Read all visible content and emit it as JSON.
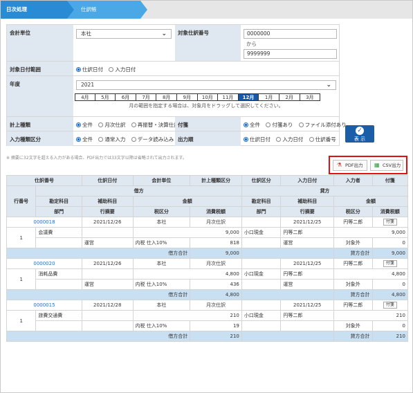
{
  "breadcrumb": {
    "step1": "日次処理",
    "step2": "仕訳帳"
  },
  "filters": {
    "company_label": "会計単位",
    "company_value": "本社",
    "voucher_label": "対象仕訳番号",
    "voucher_from": "0000000",
    "voucher_sep": "から",
    "voucher_to": "9999999",
    "date_target_label": "対象日付範囲",
    "date_target_opt1": "仕訳日付",
    "date_target_opt2": "入力日付",
    "year_label": "年度",
    "year_value": "2021",
    "months": [
      "4月",
      "5月",
      "6月",
      "7月",
      "8月",
      "9月",
      "10月",
      "11月",
      "12月",
      "1月",
      "2月",
      "3月"
    ],
    "selected_month": "12月",
    "month_hint": "月の範囲を指定する場合は、対象月をドラッグして選択してください。",
    "posting_label": "計上種類",
    "posting_opts": [
      "全件",
      "月次仕訳",
      "再振替・決算仕訳"
    ],
    "attach_label": "付箋",
    "attach_opts": [
      "全件",
      "付箋あり",
      "ファイル添付あり"
    ],
    "input_type_label": "入力種類区分",
    "input_type_opts": [
      "全件",
      "通常入力",
      "データ読み込み"
    ],
    "order_label": "出力順",
    "order_opts": [
      "仕訳日付",
      "入力日付",
      "仕訳番号"
    ]
  },
  "show_button": "表 示",
  "note": "※ 摘要に32文字を超える入力がある場合、PDF出力では33文字以降は省略されて出力されます。",
  "pdf_button": "PDF出力",
  "csv_button": "CSV出力",
  "headers": {
    "voucher_no": "仕訳番号",
    "voucher_date": "仕訳日付",
    "unit": "会計単位",
    "posting_type": "計上種類区分",
    "voucher_kind": "仕訳区分",
    "input_date": "入力日付",
    "inputter": "入力者",
    "sticky": "付箋",
    "debit": "借方",
    "credit": "貸方",
    "line_no": "行番号",
    "account": "勘定科目",
    "sub_account": "補助科目",
    "amount": "金額",
    "dept": "部門",
    "summary": "行摘要",
    "tax_class": "税区分",
    "tax_amount": "消費税額"
  },
  "entries": [
    {
      "no": "0000018",
      "date": "2021/12/26",
      "unit": "本社",
      "ptype": "月次仕訳",
      "idate": "2021/12/25",
      "user": "円等二郎",
      "tag": "付箋",
      "line": "1",
      "dacc": "会議費",
      "damt": "9,000",
      "cacc": "小口現金",
      "csub": "円等二郎",
      "camt": "9,000",
      "dsum": "運営",
      "dtax": "内税 仕入10%",
      "dtaxamt": "818",
      "csum": "運営",
      "ctax": "対象外",
      "ctaxamt": "0",
      "dtot_label": "借方合計",
      "dtot": "9,000",
      "ctot_label": "貸方合計",
      "ctot": "9,000"
    },
    {
      "no": "0000020",
      "date": "2021/12/26",
      "unit": "本社",
      "ptype": "月次仕訳",
      "idate": "2021/12/25",
      "user": "円等二郎",
      "tag": "付箋",
      "line": "1",
      "dacc": "消耗品費",
      "damt": "4,800",
      "cacc": "小口現金",
      "csub": "円等二郎",
      "camt": "4,800",
      "dsum": "運営",
      "dtax": "内税 仕入10%",
      "dtaxamt": "436",
      "csum": "運営",
      "ctax": "対象外",
      "ctaxamt": "0",
      "dtot_label": "借方合計",
      "dtot": "4,800",
      "ctot_label": "貸方合計",
      "ctot": "4,800"
    },
    {
      "no": "0000015",
      "date": "2021/12/28",
      "unit": "本社",
      "ptype": "月次仕訳",
      "idate": "2021/12/25",
      "user": "円等二郎",
      "tag": "付箋",
      "line": "1",
      "dacc": "旅費交通費",
      "damt": "210",
      "cacc": "小口現金",
      "csub": "円等二郎",
      "camt": "210",
      "dsum": "",
      "dtax": "内税 仕入10%",
      "dtaxamt": "19",
      "csum": "",
      "ctax": "対象外",
      "ctaxamt": "0",
      "dtot_label": "借方合計",
      "dtot": "210",
      "ctot_label": "貸方合計",
      "ctot": "210"
    }
  ]
}
